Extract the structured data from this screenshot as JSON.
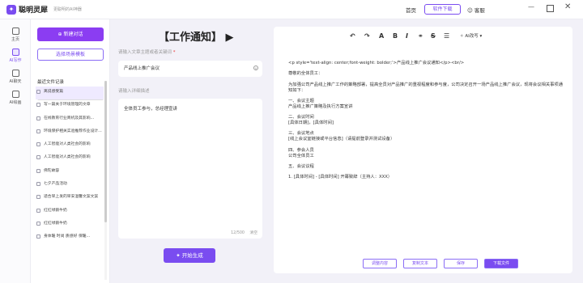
{
  "app": {
    "logo": "✦",
    "brand": "聪明灵犀",
    "slogan": "更聪明的AI神器",
    "nav_home": "首页",
    "download": "软件下载",
    "service": "客服",
    "window_controls": {
      "minimize": "—",
      "close": "✕"
    }
  },
  "rail": [
    {
      "label": "主页"
    },
    {
      "label": "AI写作"
    },
    {
      "label": "AI聊天"
    },
    {
      "label": "AI绘画"
    }
  ],
  "sidebar": {
    "new_chat": "新建对话",
    "template_btn": "选择场景模板",
    "history_title": "最近文件记录",
    "search_placeholder": "搜索历史记录",
    "items": [
      "离说感受篇",
      "写一篇关于环境管理的文章",
      "在线教育行业商机及其影响...",
      "环境保护相关实验推荐作业设计...",
      "人工智能对人类社会的影响",
      "人工智能对人类社会的影响",
      "佛陀故容",
      "七夕产品活动",
      "适合早上发的早安温馨文案文案",
      "红红绿鹅牛奶",
      "红红绿鹅牛奶",
      "身体暖 时尚 质感好 保暖..."
    ]
  },
  "editor": {
    "title": "【工作通知】",
    "topic_label": "请输入文章主题或者关键词",
    "topic_required": "*",
    "topic_value": "产品线上推广会议",
    "detail_label": "请输入详细描述",
    "detail_value": "全体员工参与，总经理宣讲",
    "counter": "12/500",
    "clear": "清空",
    "generate": "开始生成"
  },
  "output": {
    "toolbar": {
      "undo": "↶",
      "redo": "↷",
      "bold": "B",
      "italic": "I",
      "strike": "S",
      "ai": "AI改写"
    },
    "lines": [
      "<p style='text-align: center;font-weight: bolder;'>产品线上推广会议通知</p><br/>",
      "尊敬的全体员工：",
      "为加强公司产品线上推广工作的策略部署，提高全员对产品推广的重视程度和参与度，公司决定召开一场产品线上推广会议，现将会议相关事项通知如下：",
      "一、会议主题\n产品线上推广策略及执行方案宣讲",
      "二、会议时间\n[具体日期]，[具体时间]",
      "三、会议地点\n[线上会议室链接或平台信息]（请提前登录并测试设备）",
      "四、参会人员\n公司全体员工",
      "五、会议议程",
      "1. [具体时间] - [具体时间] 开幕致辞（主持人：XXX）"
    ],
    "actions": {
      "regen": "调整内容",
      "copy": "复制文本",
      "save": "保存",
      "download": "下载文件"
    }
  }
}
